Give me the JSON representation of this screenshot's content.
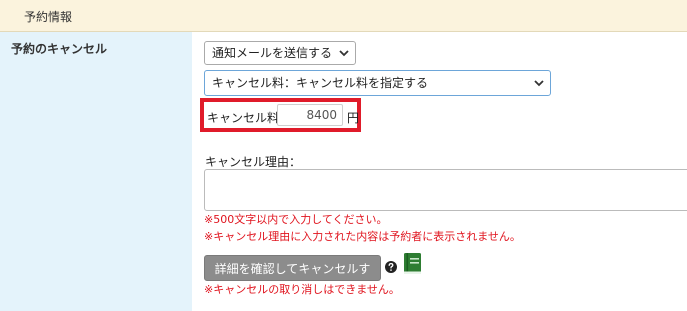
{
  "section": {
    "title": "予約情報"
  },
  "cancellation": {
    "label": "予約のキャンセル",
    "notify_select": {
      "value": "通知メールを送信する"
    },
    "fee_select": {
      "value": "キャンセル料：キャンセル料を指定する"
    },
    "fee": {
      "label": "キャンセル料",
      "value": "8400",
      "unit": "円"
    },
    "reason": {
      "label": "キャンセル理由：",
      "value": ""
    },
    "notes": [
      "※500文字以内で入力してください。",
      "※キャンセル理由に入力された内容は予約者に表示されません。"
    ],
    "confirm_button": "詳細を確認してキャンセルする",
    "final_note": "※キャンセルの取り消しはできません。"
  },
  "colors": {
    "header_bg": "#fbf3dd",
    "label_bg": "#e4f3fb",
    "highlight_border": "#e01b2a",
    "note_text": "#e0141e",
    "button_bg": "#8c8c8c",
    "manual_icon": "#2e7d32"
  },
  "icons": [
    "chevron-down-icon",
    "help-icon",
    "manual-book-icon"
  ]
}
